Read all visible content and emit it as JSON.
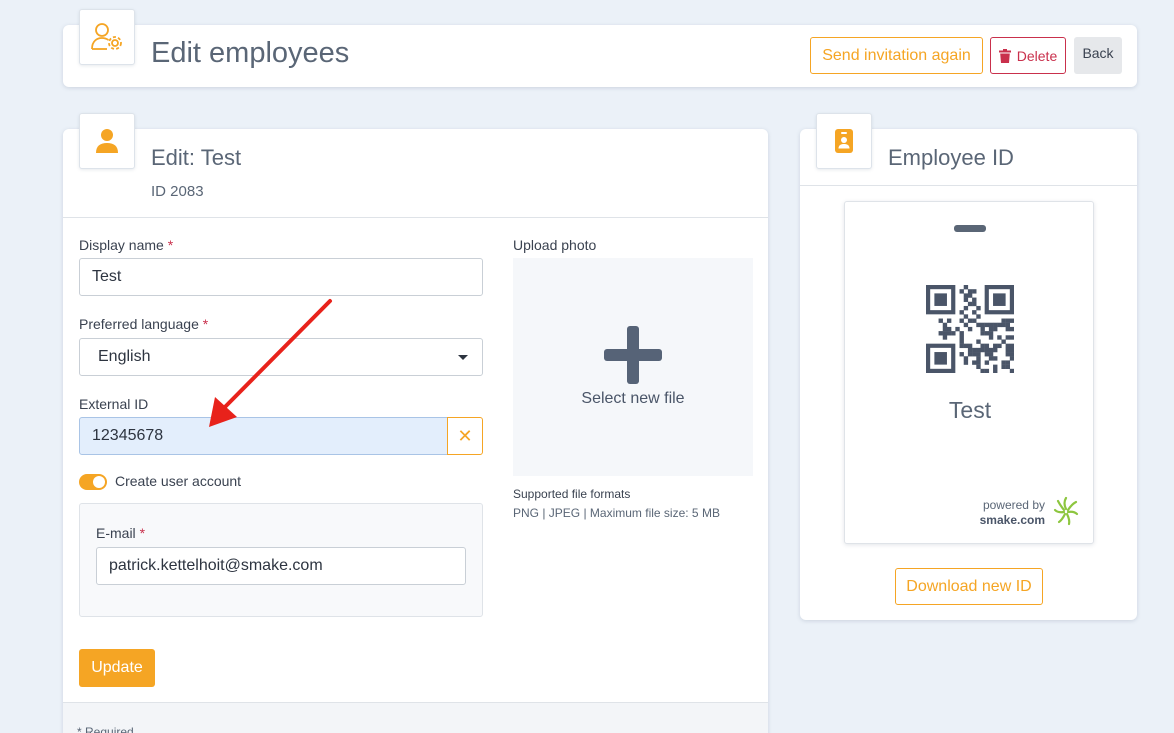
{
  "header": {
    "title": "Edit employees",
    "icon": "user-gear-icon",
    "send_invitation_label": "Send invitation again",
    "delete_label": "Delete",
    "back_label": "Back"
  },
  "edit_form": {
    "title": "Edit: Test",
    "id_text": "ID 2083",
    "display_name_label": "Display name",
    "display_name_value": "Test",
    "language_label": "Preferred language",
    "language_value": "English",
    "external_id_label": "External ID",
    "external_id_value": "12345678",
    "create_account_label": "Create user account",
    "create_account_on": true,
    "email_label": "E-mail",
    "email_value": "patrick.kettelhoit@smake.com",
    "required_mark": "*",
    "update_label": "Update",
    "required_note": "* Required",
    "upload_label": "Upload photo",
    "upload_cta": "Select new file",
    "formats_title": "Supported file formats",
    "formats_desc": "PNG | JPEG | Maximum file size: 5 MB"
  },
  "employee_id": {
    "title": "Employee ID",
    "badge_name": "Test",
    "powered_by": "powered by",
    "powered_domain": "smake.com",
    "download_label": "Download new ID"
  },
  "colors": {
    "accent": "#f5a524",
    "danger": "#c9304c",
    "background": "#ebf1f8",
    "annotation_arrow": "#e8221b"
  }
}
